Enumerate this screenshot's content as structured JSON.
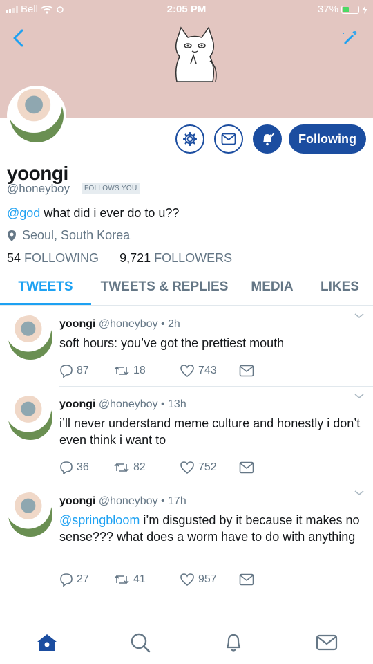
{
  "status_bar": {
    "carrier": "Bell",
    "time": "2:05 PM",
    "battery": "37%"
  },
  "profile": {
    "name": "yoongi",
    "handle": "@honeyboy",
    "follows_you": "FOLLOWS YOU",
    "bio_mention": "@god",
    "bio_text": " what did i ever do to u??",
    "location": "Seoul, South Korea",
    "following_count": "54",
    "following_label": "FOLLOWING",
    "followers_count": "9,721",
    "followers_label": "FOLLOWERS",
    "follow_button": "Following"
  },
  "tabs": [
    {
      "label": "TWEETS"
    },
    {
      "label": "TWEETS & REPLIES"
    },
    {
      "label": "MEDIA"
    },
    {
      "label": "LIKES"
    }
  ],
  "tweets": [
    {
      "name": "yoongi",
      "handle": "@honeyboy",
      "time": "2h",
      "mention": "",
      "text": "soft hours: you’ve got the prettiest mouth",
      "replies": "87",
      "retweets": "18",
      "likes": "743"
    },
    {
      "name": "yoongi",
      "handle": "@honeyboy",
      "time": "13h",
      "mention": "",
      "text": "i’ll never understand meme culture and honestly i don’t even think i want to",
      "replies": "36",
      "retweets": "82",
      "likes": "752"
    },
    {
      "name": "yoongi",
      "handle": "@honeyboy",
      "time": "17h",
      "mention": "@springbloom",
      "text": " i’m disgusted by it because it makes no sense??? what does a worm have to do with anything",
      "replies": "27",
      "retweets": "41",
      "likes": "957"
    }
  ],
  "colors": {
    "header_bg": "#e3c6c1",
    "brand_blue": "#1b4da0",
    "link_blue": "#1da1f2",
    "gray": "#657786"
  },
  "icons": [
    "back-arrow-icon",
    "compose-icon",
    "cat-banner-icon",
    "gear-icon",
    "mail-icon",
    "bell-icon",
    "location-pin-icon",
    "reply-icon",
    "retweet-icon",
    "heart-icon",
    "dm-icon",
    "home-icon",
    "search-icon",
    "notifications-icon",
    "messages-icon"
  ]
}
